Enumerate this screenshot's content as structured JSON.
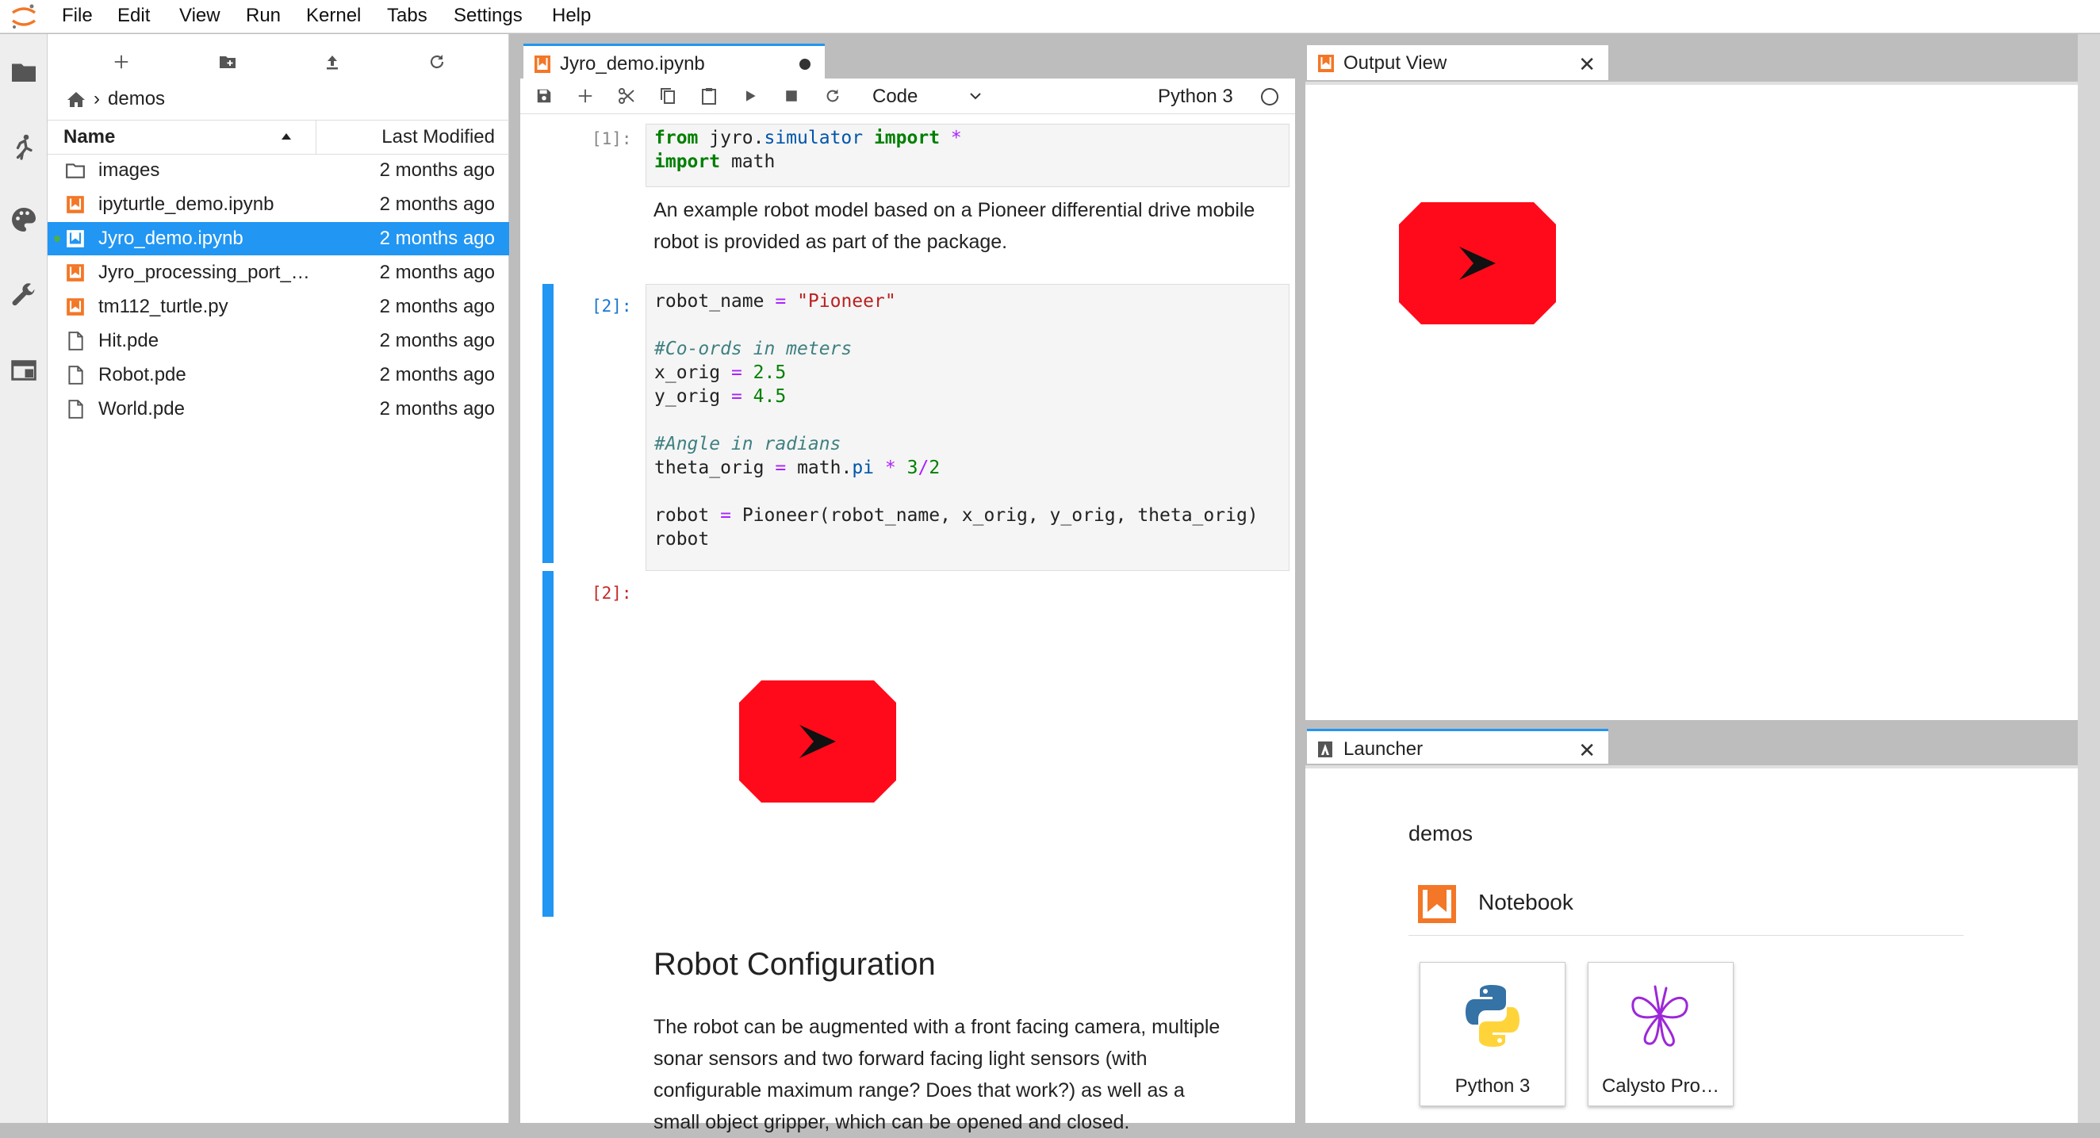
{
  "menubar": {
    "logo_icon": "jupyter-logo-icon",
    "items": [
      "File",
      "Edit",
      "View",
      "Run",
      "Kernel",
      "Tabs",
      "Settings",
      "Help"
    ]
  },
  "left_sidebar": {
    "icons": [
      "folder-icon",
      "running-icon",
      "palette-icon",
      "wrench-icon",
      "tabs-icon"
    ]
  },
  "file_browser": {
    "toolbar_icons": [
      "new-launcher-icon",
      "new-folder-icon",
      "upload-icon",
      "refresh-icon"
    ],
    "breadcrumb": {
      "home_icon": "home-icon",
      "separator": "›",
      "folder": "demos"
    },
    "headers": {
      "name": "Name",
      "modified": "Last Modified"
    },
    "files": [
      {
        "name": "images",
        "modified": "2 months ago",
        "type": "folder"
      },
      {
        "name": "ipyturtle_demo.ipynb",
        "modified": "2 months ago",
        "type": "notebook"
      },
      {
        "name": "Jyro_demo.ipynb",
        "modified": "2 months ago",
        "type": "notebook",
        "selected": true
      },
      {
        "name": "Jyro_processing_port_…",
        "modified": "2 months ago",
        "type": "notebook"
      },
      {
        "name": "tm112_turtle.py",
        "modified": "2 months ago",
        "type": "python"
      },
      {
        "name": "Hit.pde",
        "modified": "2 months ago",
        "type": "file"
      },
      {
        "name": "Robot.pde",
        "modified": "2 months ago",
        "type": "file"
      },
      {
        "name": "World.pde",
        "modified": "2 months ago",
        "type": "file"
      }
    ]
  },
  "notebook": {
    "tab_title": "Jyro_demo.ipynb",
    "cell_type": "Code",
    "kernel": "Python 3",
    "cells": {
      "c1_prompt": "[1]:",
      "c1_line1": {
        "a": "from",
        "b": " jyro.",
        "c": "simulator",
        "d": " import",
        "e": " *"
      },
      "c1_line2": {
        "a": "import",
        "b": " math"
      },
      "md1": "An example robot model based on a Pioneer differential drive mobile robot is provided as part of the package.",
      "c2_prompt": "[2]:",
      "c2_robot_name": "robot_name",
      "c2_eq": "=",
      "c2_pioneer_str": "\"Pioneer\"",
      "c2_comment1": "#Co-ords in meters",
      "c2_xorig": "x_orig",
      "c2_xval": "2.5",
      "c2_yorig": "y_orig",
      "c2_yval": "4.5",
      "c2_comment2": "#Angle in radians",
      "c2_theta": "theta_orig",
      "c2_math": "math.",
      "c2_pi": "pi",
      "c2_mul": "*",
      "c2_three": "3",
      "c2_div": "/",
      "c2_two": "2",
      "c2_robot": "robot",
      "c2_call": "Pioneer(robot_name, x_orig, y_orig, theta_orig)",
      "c2_last": "robot",
      "out_prompt": "[2]:",
      "heading": "Robot Configuration",
      "md2": "The robot can be augmented with a front facing camera, multiple sonar sensors and two forward facing light sensors (with configurable maximum range? Does that work?) as well as a small object gripper, which can be opened and closed."
    }
  },
  "output_view": {
    "tab_title": "Output View"
  },
  "launcher": {
    "tab_title": "Launcher",
    "folder": "demos",
    "section": "Notebook",
    "cards": [
      {
        "label": "Python 3",
        "icon": "python-logo-icon"
      },
      {
        "label": "Calysto Pro…",
        "icon": "calysto-logo-icon"
      }
    ]
  },
  "colors": {
    "accent": "#2196f3",
    "notebook_icon": "#f37726",
    "robot_fill": "#ff0a1a"
  }
}
